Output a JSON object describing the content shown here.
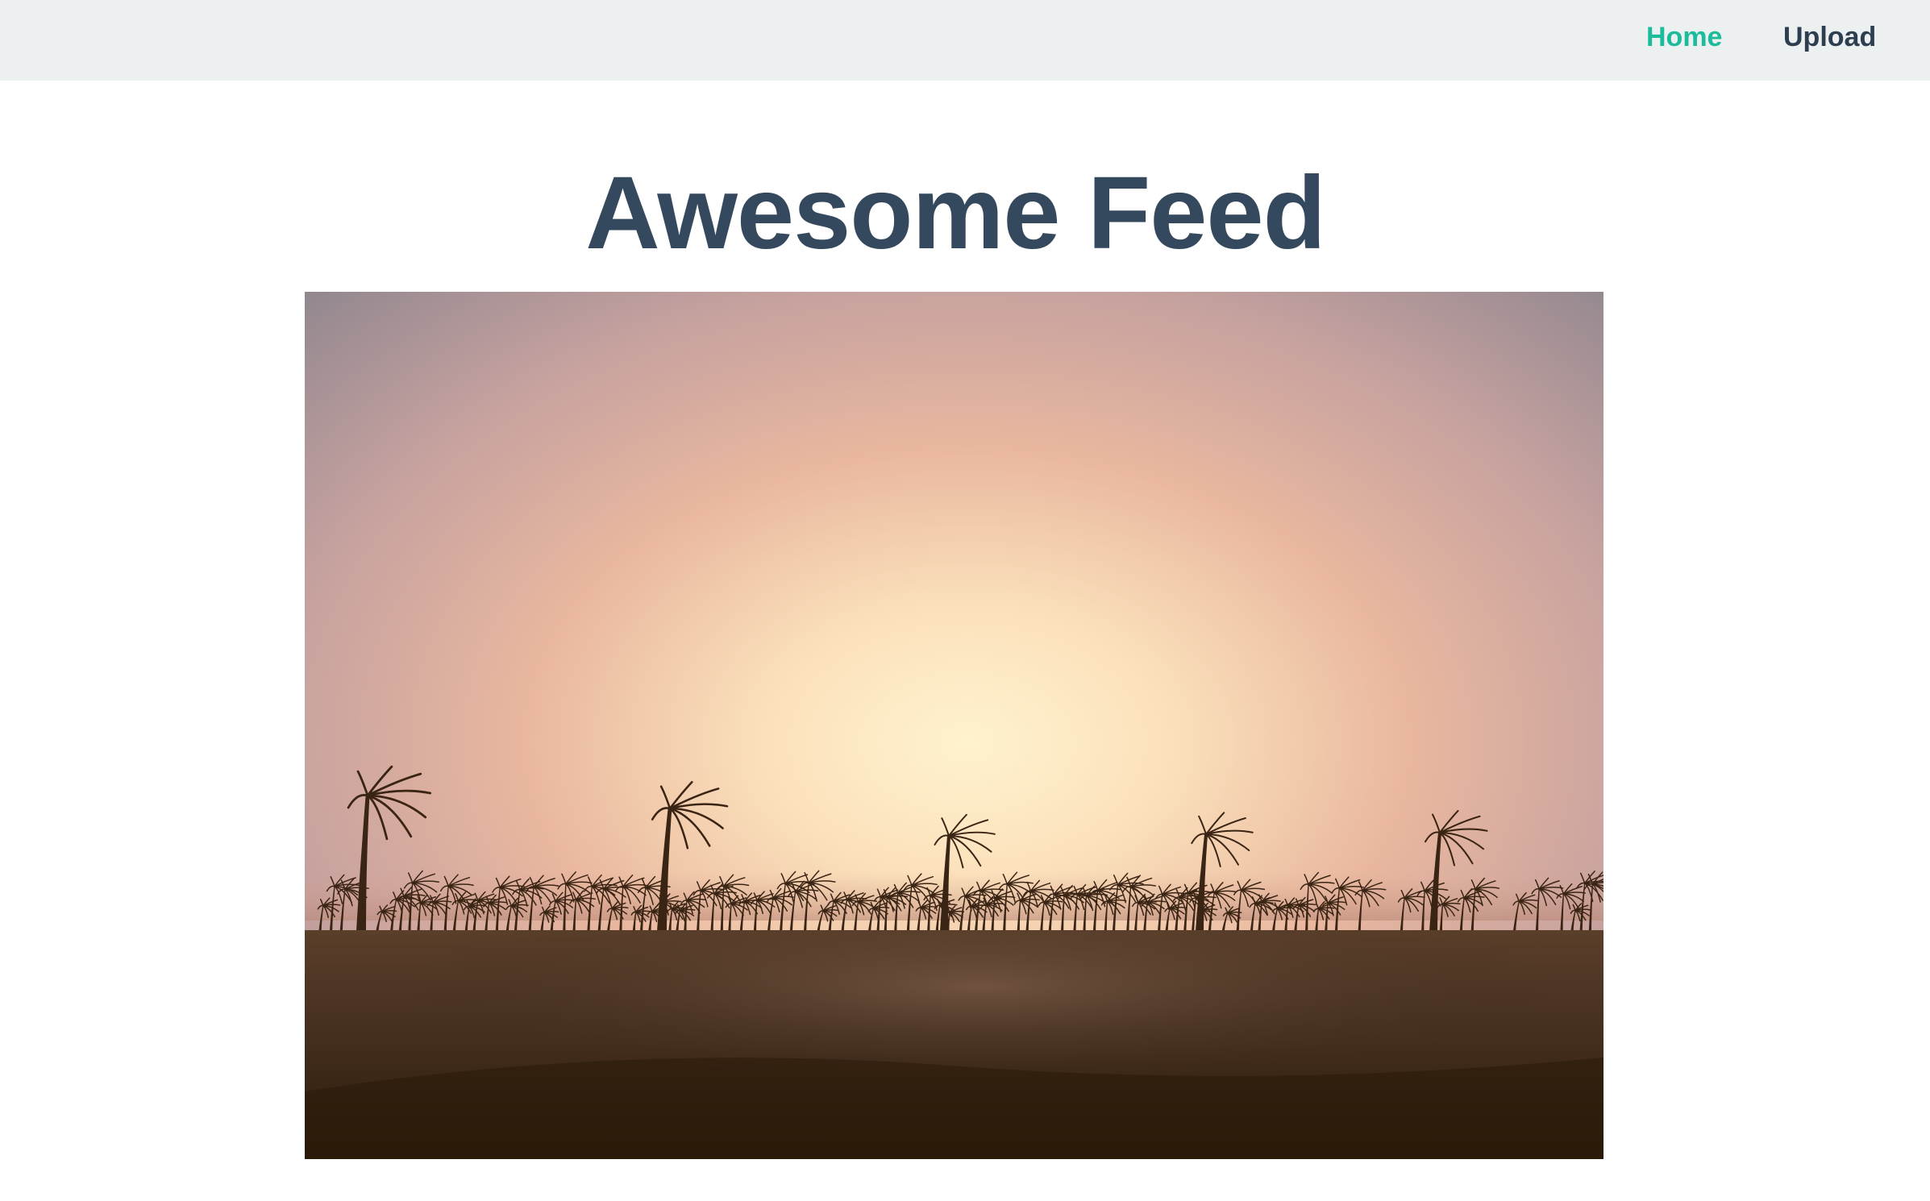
{
  "nav": {
    "home_label": "Home",
    "upload_label": "Upload",
    "active": "home",
    "active_color": "#1abc9c",
    "text_color": "#2c3e50",
    "bar_color": "#ecf0f1"
  },
  "main": {
    "title": "Awesome Feed",
    "title_color": "#34495e"
  },
  "feed": {
    "posts": [
      {
        "image": "sunset-palm-trees-silhouette"
      }
    ]
  }
}
